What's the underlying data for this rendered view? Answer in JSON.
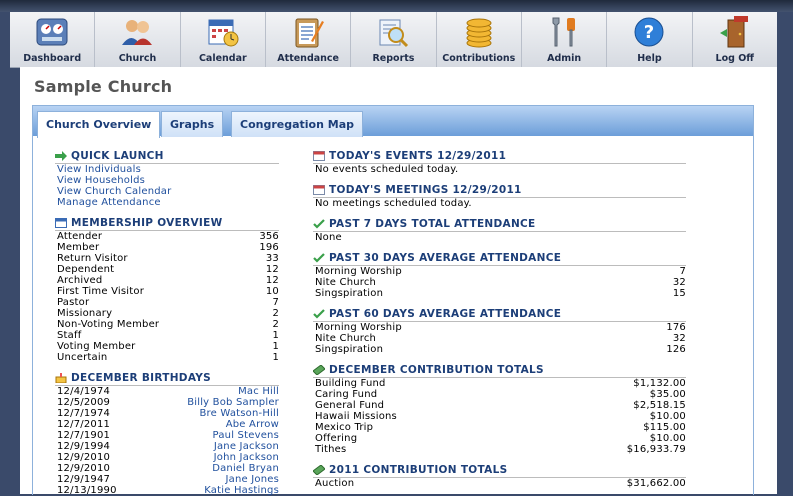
{
  "nav": [
    {
      "label": "Dashboard",
      "icon": "dashboard-icon"
    },
    {
      "label": "Church",
      "icon": "people-icon"
    },
    {
      "label": "Calendar",
      "icon": "calendar-icon"
    },
    {
      "label": "Attendance",
      "icon": "clipboard-icon"
    },
    {
      "label": "Reports",
      "icon": "reports-icon"
    },
    {
      "label": "Contributions",
      "icon": "coins-icon"
    },
    {
      "label": "Admin",
      "icon": "wrench-icon"
    },
    {
      "label": "Help",
      "icon": "help-icon"
    },
    {
      "label": "Log Off",
      "icon": "exit-door-icon"
    }
  ],
  "page_title": "Sample Church",
  "tabs": [
    "Church Overview",
    "Graphs",
    "Congregation Map"
  ],
  "quick_launch": {
    "title": "QUICK LAUNCH",
    "links": [
      "View Individuals",
      "View Households",
      "View Church Calendar",
      "Manage Attendance"
    ]
  },
  "membership": {
    "title": "MEMBERSHIP OVERVIEW",
    "rows": [
      {
        "label": "Attender",
        "value": "356"
      },
      {
        "label": "Member",
        "value": "196"
      },
      {
        "label": "Return Visitor",
        "value": "33"
      },
      {
        "label": "Dependent",
        "value": "12"
      },
      {
        "label": "Archived",
        "value": "12"
      },
      {
        "label": "First Time Visitor",
        "value": "10"
      },
      {
        "label": "Pastor",
        "value": "7"
      },
      {
        "label": "Missionary",
        "value": "2"
      },
      {
        "label": "Non-Voting Member",
        "value": "2"
      },
      {
        "label": "Staff",
        "value": "1"
      },
      {
        "label": "Voting Member",
        "value": "1"
      },
      {
        "label": "Uncertain",
        "value": "1"
      }
    ]
  },
  "birthdays": {
    "title": "DECEMBER BIRTHDAYS",
    "rows": [
      {
        "date": "12/4/1974",
        "name": "Mac Hill"
      },
      {
        "date": "12/5/2009",
        "name": "Billy Bob Sampler"
      },
      {
        "date": "12/7/1974",
        "name": "Bre Watson-Hill"
      },
      {
        "date": "12/7/2011",
        "name": "Abe Arrow"
      },
      {
        "date": "12/7/1901",
        "name": "Paul Stevens"
      },
      {
        "date": "12/9/1994",
        "name": "Jane Jackson"
      },
      {
        "date": "12/9/2010",
        "name": "John Jackson"
      },
      {
        "date": "12/9/2010",
        "name": "Daniel Bryan"
      },
      {
        "date": "12/9/1947",
        "name": "Jane Jones"
      },
      {
        "date": "12/13/1990",
        "name": "Katie Hastings"
      }
    ]
  },
  "events": {
    "title": "TODAY'S EVENTS 12/29/2011",
    "text": "No events scheduled today."
  },
  "meetings": {
    "title": "TODAY'S MEETINGS 12/29/2011",
    "text": "No meetings scheduled today."
  },
  "past7": {
    "title": "PAST 7 DAYS TOTAL ATTENDANCE",
    "text": "None"
  },
  "past30": {
    "title": "PAST 30 DAYS AVERAGE ATTENDANCE",
    "rows": [
      {
        "label": "Morning Worship",
        "value": "7"
      },
      {
        "label": "Nite Church",
        "value": "32"
      },
      {
        "label": "Singspiration",
        "value": "15"
      }
    ]
  },
  "past60": {
    "title": "PAST 60 DAYS AVERAGE ATTENDANCE",
    "rows": [
      {
        "label": "Morning Worship",
        "value": "176"
      },
      {
        "label": "Nite Church",
        "value": "32"
      },
      {
        "label": "Singspiration",
        "value": "126"
      }
    ]
  },
  "dec_contrib": {
    "title": "DECEMBER CONTRIBUTION TOTALS",
    "rows": [
      {
        "label": "Building Fund",
        "value": "$1,132.00"
      },
      {
        "label": "Caring Fund",
        "value": "$35.00"
      },
      {
        "label": "General Fund",
        "value": "$2,518.15"
      },
      {
        "label": "Hawaii Missions",
        "value": "$10.00"
      },
      {
        "label": "Mexico Trip",
        "value": "$115.00"
      },
      {
        "label": "Offering",
        "value": "$10.00"
      },
      {
        "label": "Tithes",
        "value": "$16,933.79"
      }
    ]
  },
  "year_contrib": {
    "title": "2011 CONTRIBUTION TOTALS",
    "rows": [
      {
        "label": "Auction",
        "value": "$31,662.00"
      }
    ]
  },
  "colors": {
    "accent": "#1c3e78",
    "link": "#1f4f9d",
    "tabbar": "#6c9ed9"
  }
}
